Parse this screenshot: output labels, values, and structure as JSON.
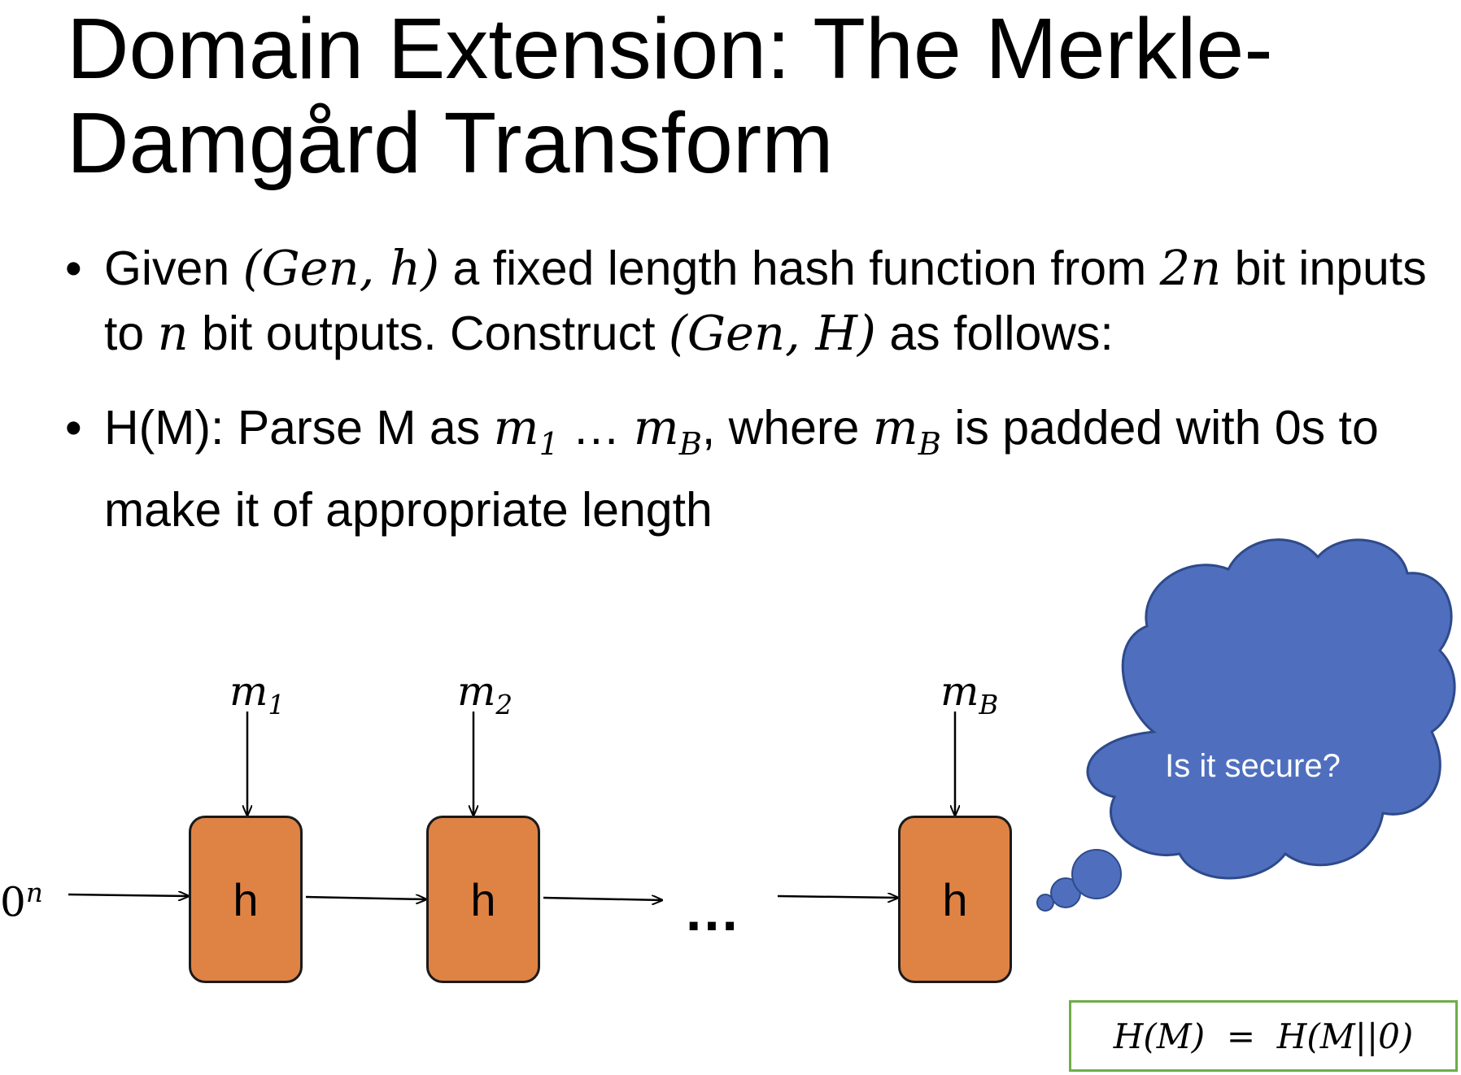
{
  "slide": {
    "title_line1": "Domain Extension: The Merkle-",
    "title_line2": "Damgård Transform"
  },
  "bullets": {
    "b1": {
      "t1": "Given ",
      "m1": "(Gen, h)",
      "t2": " a fixed length hash function from ",
      "m2": "2n",
      "t3": " bit inputs to ",
      "m3": "n",
      "t4": " bit outputs. Construct ",
      "m4": "(Gen, H)",
      "t5": " as follows:"
    },
    "b2": {
      "t1": "H(M): Parse M as ",
      "m1_base": "m",
      "m1_sub": "1",
      "t2": " … ",
      "m2_base": "m",
      "m2_sub": "B",
      "t3": ", where ",
      "m3_base": "m",
      "m3_sub": "B",
      "t4": " is padded with 0s to make it of appropriate length"
    }
  },
  "diagram": {
    "iv_base": "0",
    "iv_sup": "n",
    "inputs": [
      {
        "base": "m",
        "sub": "1"
      },
      {
        "base": "m",
        "sub": "2"
      },
      {
        "base": "m",
        "sub": "B"
      }
    ],
    "box_label": "h",
    "ellipsis": "…",
    "cloud_text": "Is it secure?",
    "equation": "H(M)  =  H(M||0)",
    "colors": {
      "box_fill": "#df8344",
      "cloud_fill": "#4f6fbe",
      "equation_border": "#70ad47"
    }
  }
}
